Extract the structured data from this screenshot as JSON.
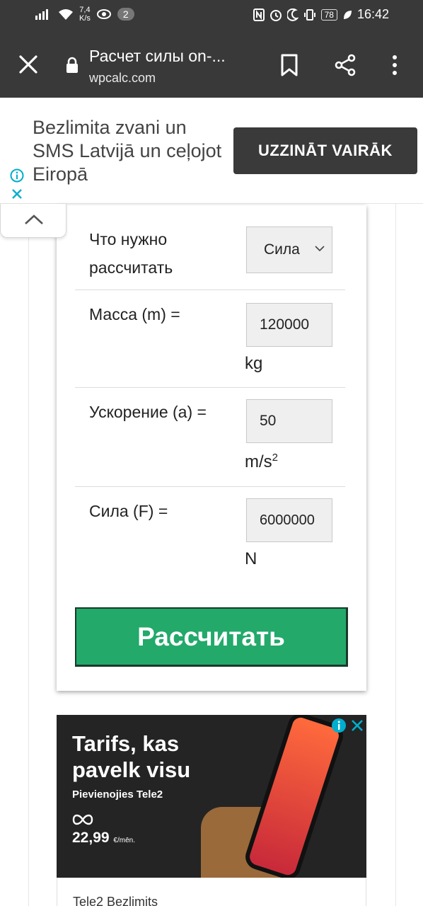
{
  "status_bar": {
    "speed_value": "7,4",
    "speed_unit": "K/s",
    "notification_count": "2",
    "battery": "78",
    "time": "16:42"
  },
  "toolbar": {
    "title": "Расчет силы on-...",
    "url": "wpcalc.com"
  },
  "ad_top": {
    "text": "Bezlimita zvani un SMS Latvijā un ceļojot Eiropā",
    "button_label": "UZZINĀT VAIRĀK"
  },
  "calculator": {
    "rows": [
      {
        "label": "Что нужно рассчитать",
        "select_value": "Сила"
      },
      {
        "label": "Масса (m) =",
        "input_value": "120000",
        "unit": "kg"
      },
      {
        "label": "Ускорение (a) =",
        "input_value": "50",
        "unit": "m/s",
        "unit_sup": "2"
      },
      {
        "label": "Сила (F) =",
        "input_value": "6000000",
        "unit": "N"
      }
    ],
    "button_label": "Рассчитать"
  },
  "ad_bottom": {
    "headline": "Tarifs, kas pavelk visu",
    "subline": "Pievienojies Tele2",
    "price": "22,99",
    "price_unit": "€/mēn.",
    "footer_text": "Tele2 Bezlimits"
  }
}
